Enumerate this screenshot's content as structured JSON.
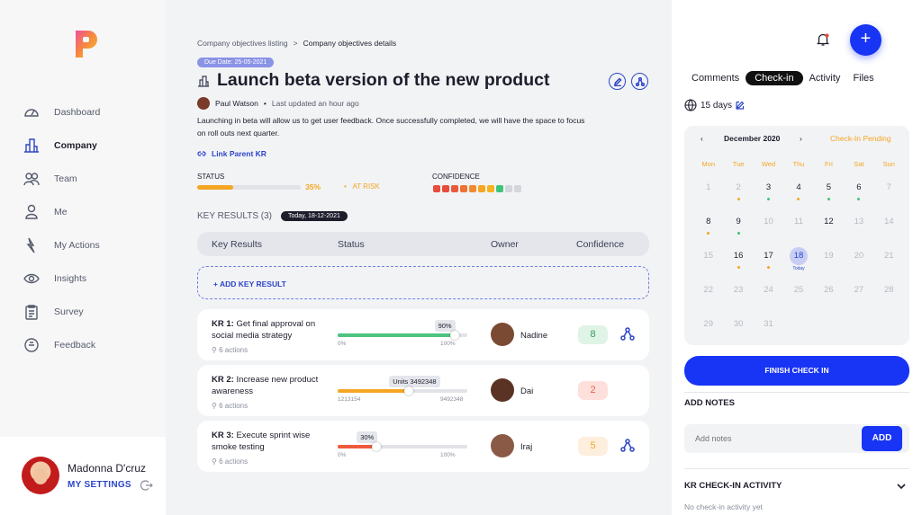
{
  "sidebar": {
    "items": [
      {
        "label": "Dashboard",
        "icon": "gauge-icon"
      },
      {
        "label": "Company",
        "icon": "buildings-icon",
        "active": true
      },
      {
        "label": "Team",
        "icon": "team-icon"
      },
      {
        "label": "Me",
        "icon": "person-icon"
      },
      {
        "label": "My Actions",
        "icon": "lightning-icon"
      },
      {
        "label": "Insights",
        "icon": "eye-icon"
      },
      {
        "label": "Survey",
        "icon": "clipboard-icon"
      },
      {
        "label": "Feedback",
        "icon": "chat-icon"
      }
    ],
    "user": {
      "name": "Madonna D'cruz",
      "settings_label": "MY SETTINGS"
    }
  },
  "main": {
    "breadcrumb": {
      "parent": "Company objectives listing",
      "separator": ">",
      "current": "Company objectives details"
    },
    "due_badge": "Due Date:  25-05-2021",
    "title": "Launch beta version of the new product",
    "owner": {
      "name": "Paul Watson",
      "updated": "Last updated an hour ago"
    },
    "description": "Launching in beta will allow us to get user feedback. Once successfully completed, we will have the space to focus on roll outs next quarter.",
    "link_parent": "Link Parent KR",
    "status": {
      "label": "STATUS",
      "percent_text": "35%",
      "value": 0.35,
      "risk": "AT RISK",
      "color": "#f5a623"
    },
    "confidence": {
      "label": "CONFIDENCE",
      "dots": [
        "#e84c3d",
        "#e84c3d",
        "#ea5a3a",
        "#ef7234",
        "#f18a2e",
        "#f5a623",
        "#f5b41e",
        "#3ec47a",
        "#d4d6dc",
        "#d4d6dc"
      ]
    },
    "kr_heading": "KEY RESULTS (3)",
    "today_badge": "Today, 18-12-2021",
    "table_headers": {
      "key_results": "Key Results",
      "status": "Status",
      "owner": "Owner",
      "confidence": "Confidence"
    },
    "add_kr": "+ ADD KEY RESULT",
    "key_results": [
      {
        "prefix": "KR 1:",
        "title": "Get final approval on social media strategy",
        "actions": "6 actions",
        "progress": 0.9,
        "tip": "90%",
        "min": "0%",
        "max": "100%",
        "color": "#4cc47f",
        "owner": "Nadine",
        "confidence": "8",
        "conf_bg": "#dff3e6",
        "conf_fg": "#2f9e5b",
        "show_link": true
      },
      {
        "prefix": "KR 2:",
        "title": "Increase new product awareness",
        "actions": "6 actions",
        "progress": 0.55,
        "tip": "Units 3492348",
        "min": "1213154",
        "max": "9492348",
        "color": "#f5a623",
        "owner": "Dai",
        "confidence": "2",
        "conf_bg": "#fde0db",
        "conf_fg": "#e8614a",
        "show_link": false
      },
      {
        "prefix": "KR 3:",
        "title": "Execute sprint wise smoke testing",
        "actions": "6 actions",
        "progress": 0.3,
        "tip": "30%",
        "min": "0%",
        "max": "100%",
        "color": "#ef5a3c",
        "owner": "Iraj",
        "confidence": "5",
        "conf_bg": "#fdeede",
        "conf_fg": "#f5a623",
        "show_link": true
      }
    ]
  },
  "right": {
    "tabs": [
      {
        "label": "Comments"
      },
      {
        "label": "Check-in",
        "active": true
      },
      {
        "label": "Activity"
      },
      {
        "label": "Files"
      }
    ],
    "days": "15 days",
    "calendar": {
      "month": "December 2020",
      "prev": "‹",
      "next": "›",
      "status": "Check-In Pending",
      "dow": [
        "Mon",
        "Tue",
        "Wed",
        "Thu",
        "Fri",
        "Sat",
        "Sun"
      ],
      "days": [
        {
          "n": "1"
        },
        {
          "n": "2",
          "dark": false,
          "dot": "#f5a623"
        },
        {
          "n": "3",
          "dark": true,
          "dot": "#3ec47a"
        },
        {
          "n": "4",
          "dark": true,
          "dot": "#f5a623"
        },
        {
          "n": "5",
          "dark": true,
          "dot": "#3ec47a"
        },
        {
          "n": "6",
          "dark": true,
          "dot": "#3ec47a"
        },
        {
          "n": "7"
        },
        {
          "n": "8",
          "dark": true,
          "dot": "#f5a623"
        },
        {
          "n": "9",
          "dark": true,
          "dot": "#3ec47a"
        },
        {
          "n": "10"
        },
        {
          "n": "11"
        },
        {
          "n": "12",
          "dark": true
        },
        {
          "n": "13"
        },
        {
          "n": "14"
        },
        {
          "n": "15"
        },
        {
          "n": "16",
          "dark": true,
          "dot": "#f5a623"
        },
        {
          "n": "17",
          "dark": true,
          "dot": "#f5a623"
        },
        {
          "n": "18",
          "today": true,
          "today_label": "Today"
        },
        {
          "n": "19"
        },
        {
          "n": "20"
        },
        {
          "n": "21"
        },
        {
          "n": "22"
        },
        {
          "n": "23"
        },
        {
          "n": "24"
        },
        {
          "n": "25"
        },
        {
          "n": "26"
        },
        {
          "n": "27"
        },
        {
          "n": "28"
        },
        {
          "n": "29"
        },
        {
          "n": "30"
        },
        {
          "n": "31"
        },
        {
          "n": ""
        },
        {
          "n": ""
        },
        {
          "n": ""
        },
        {
          "n": ""
        }
      ]
    },
    "finish_label": "FINISH CHECK IN",
    "notes_title": "ADD NOTES",
    "notes_placeholder": "Add notes",
    "add_label": "ADD",
    "activity_title": "KR CHECK-IN ACTIVITY",
    "no_activity": "No check-in activity yet",
    "accent": "#1834f5"
  }
}
